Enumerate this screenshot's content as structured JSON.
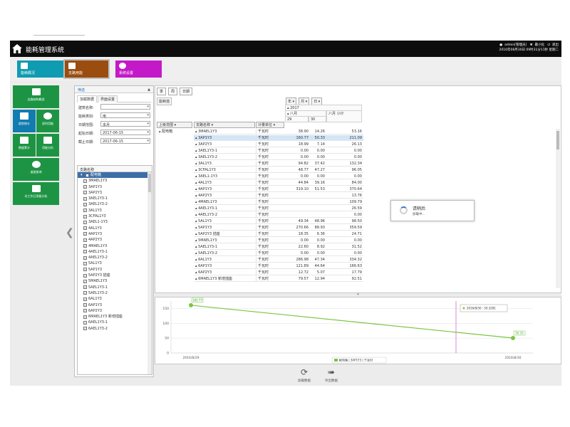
{
  "app": {
    "title": "能耗管理系统"
  },
  "header": {
    "user": "admin[管理员]",
    "minimize": "最小化",
    "logout": "退出",
    "datetime": "2016年08月30日 09时31分11秒 星期二"
  },
  "modules": [
    {
      "label": "能耗概况",
      "color": "#0f9bb1",
      "icon": "chart-icon"
    },
    {
      "label": "支路用能",
      "color": "#9b4d10",
      "icon": "meter-icon"
    },
    {
      "label": "系统设置",
      "color": "#c419c9",
      "icon": "gear-icon"
    }
  ],
  "sidebar": [
    {
      "label": "支路结构概述",
      "icon": "book-icon"
    },
    {
      "label": "趋势统计",
      "icon": "trend-icon"
    },
    {
      "label": "逐时用能",
      "icon": "clock-icon"
    },
    {
      "label": "数据累计",
      "icon": "document-icon"
    },
    {
      "label": "用能分析",
      "icon": "database-icon"
    },
    {
      "label": "谐波查询",
      "icon": "gauge-icon"
    },
    {
      "label": "非工作日用能分析",
      "icon": "calendar-icon"
    }
  ],
  "filter": {
    "title": "筛选",
    "tabs": [
      "加载数据",
      "界面设置"
    ],
    "rows": [
      {
        "label": "建筑名称:",
        "value": ""
      },
      {
        "label": "能耗类别:",
        "value": "电"
      },
      {
        "label": "日期范围:",
        "value": "本月"
      },
      {
        "label": "起始日期:",
        "value": "2017-06-15"
      },
      {
        "label": "截止日期:",
        "value": "2017-06-15"
      }
    ],
    "branch_header": "支路名称",
    "branch_root": "配电箱",
    "branches": [
      "3MAEL1Y3",
      "3AP1Y3",
      "3AP2Y3",
      "3AEL1Y3-1",
      "3AEL1Y3-2",
      "3AL1Y3",
      "3CFAL1Y3",
      "3AEL1-1Y3",
      "4AL1Y3",
      "4AP1Y3",
      "4AP2Y3",
      "4MAEL1Y3",
      "4AEL1Y3-1",
      "4AEL1Y3-2",
      "5AL1Y3",
      "5AP1Y3",
      "5AP2Y3 插座",
      "5MAEL1Y3",
      "5AEL1Y3-1",
      "5AEL1Y3-2",
      "6AL1Y3",
      "6AP1Y3",
      "6AP2Y3",
      "6MAEL1Y3 新增插座",
      "6AEL1Y3-1",
      "6AEL1Y3-2"
    ]
  },
  "pivot": {
    "view_buttons": [
      "季",
      "周",
      "日期"
    ],
    "sum_field": "能耗值",
    "col_fields": [
      "年 ▾",
      "月 ▾",
      "日 ▾"
    ],
    "col_year": "▴ 2017",
    "col_month": "▴ 八月",
    "col_subtotal": "八月 小计",
    "col_day1": "29",
    "col_day2": "30",
    "row_fields": [
      "上级范围",
      "支路名称",
      "计量单位"
    ],
    "category": "▴ 配电箱",
    "rows": [
      {
        "name": "▴ 3MAEL1Y3",
        "unit": "千瓦时",
        "v1": "38.90",
        "v2": "14.26",
        "v3": "53.16"
      },
      {
        "name": "▴ 3AP1Y3",
        "unit": "千瓦时",
        "v1": "160.77",
        "v2": "50.33",
        "v3": "211.09"
      },
      {
        "name": "▴ 3AP2Y3",
        "unit": "千瓦时",
        "v1": "18.99",
        "v2": "7.14",
        "v3": "26.13"
      },
      {
        "name": "▴ 3AEL1Y3-1",
        "unit": "千瓦时",
        "v1": "0.00",
        "v2": "0.00",
        "v3": "0.00"
      },
      {
        "name": "▴ 3AEL1Y3-2",
        "unit": "千瓦时",
        "v1": "0.00",
        "v2": "0.00",
        "v3": "0.00"
      },
      {
        "name": "▴ 3AL1Y3",
        "unit": "千瓦时",
        "v1": "94.82",
        "v2": "37.42",
        "v3": "132.34"
      },
      {
        "name": "▴ 3CFAL1Y3",
        "unit": "千瓦时",
        "v1": "48.77",
        "v2": "47.27",
        "v3": "96.05"
      },
      {
        "name": "▴ 3AEL1-1Y3",
        "unit": "千瓦时",
        "v1": "0.00",
        "v2": "0.00",
        "v3": "0.00"
      },
      {
        "name": "▴ 4AL1Y3",
        "unit": "千瓦时",
        "v1": "44.84",
        "v2": "39.16",
        "v3": "84.00"
      },
      {
        "name": "▴ 4AP1Y3",
        "unit": "千瓦时",
        "v1": "319.10",
        "v2": "51.53",
        "v3": "370.64"
      },
      {
        "name": "▴ 4AP2Y3",
        "unit": "千瓦时",
        "v1": "",
        "v2": "",
        "v3": "13.76"
      },
      {
        "name": "▴ 4MAEL1Y3",
        "unit": "千瓦时",
        "v1": "",
        "v2": "",
        "v3": "109.79"
      },
      {
        "name": "▴ 4AEL1Y3-1",
        "unit": "千瓦时",
        "v1": "",
        "v2": "",
        "v3": "26.59"
      },
      {
        "name": "▴ 4AEL1Y3-2",
        "unit": "千瓦时",
        "v1": "",
        "v2": "",
        "v3": "0.00"
      },
      {
        "name": "▴ 5AL1Y3",
        "unit": "千瓦时",
        "v1": "49.34",
        "v2": "48.96",
        "v3": "98.50"
      },
      {
        "name": "▴ 5AP1Y3",
        "unit": "千瓦时",
        "v1": "270.66",
        "v2": "88.93",
        "v3": "359.59"
      },
      {
        "name": "▴ 5AP2Y3 插座",
        "unit": "千瓦时",
        "v1": "18.35",
        "v2": "6.36",
        "v3": "24.71"
      },
      {
        "name": "▴ 5MAEL1Y3",
        "unit": "千瓦时",
        "v1": "0.00",
        "v2": "0.00",
        "v3": "0.00"
      },
      {
        "name": "▴ 5AEL1Y3-1",
        "unit": "千瓦时",
        "v1": "22.60",
        "v2": "8.92",
        "v3": "31.52"
      },
      {
        "name": "▴ 5AEL1Y3-2",
        "unit": "千瓦时",
        "v1": "0.00",
        "v2": "0.00",
        "v3": "0.00"
      },
      {
        "name": "▴ 6AL1Y3",
        "unit": "千瓦时",
        "v1": "286.98",
        "v2": "47.34",
        "v3": "334.32"
      },
      {
        "name": "▴ 6AP1Y3",
        "unit": "千瓦时",
        "v1": "121.89",
        "v2": "44.64",
        "v3": "166.63"
      },
      {
        "name": "▴ 6AP2Y3",
        "unit": "千瓦时",
        "v1": "12.72",
        "v2": "5.07",
        "v3": "17.79"
      },
      {
        "name": "▴ 6MAEL1Y3 新增插座",
        "unit": "千瓦时",
        "v1": "79.57",
        "v2": "12.94",
        "v3": "92.51"
      }
    ]
  },
  "loading": {
    "title": "请稍后",
    "subtitle": "加载中..."
  },
  "chart_data": {
    "type": "line",
    "x": [
      "2016/8/29",
      "2016/8/30"
    ],
    "series": [
      {
        "name": "配电箱 | 3AP1Y3 | 千瓦时",
        "values": [
          160.77,
          50.33
        ],
        "color": "#7cc542"
      }
    ],
    "point_labels": [
      "160.77",
      "50.33"
    ],
    "yticks": [
      "0",
      "50",
      "100",
      "150"
    ],
    "ylim": [
      0,
      175
    ],
    "tooltip": "2016/8/30 : 50.3281",
    "legend": "bottom"
  },
  "actions": [
    {
      "label": "加载数据",
      "icon": "refresh-icon"
    },
    {
      "label": "导出数据",
      "icon": "export-icon"
    }
  ]
}
